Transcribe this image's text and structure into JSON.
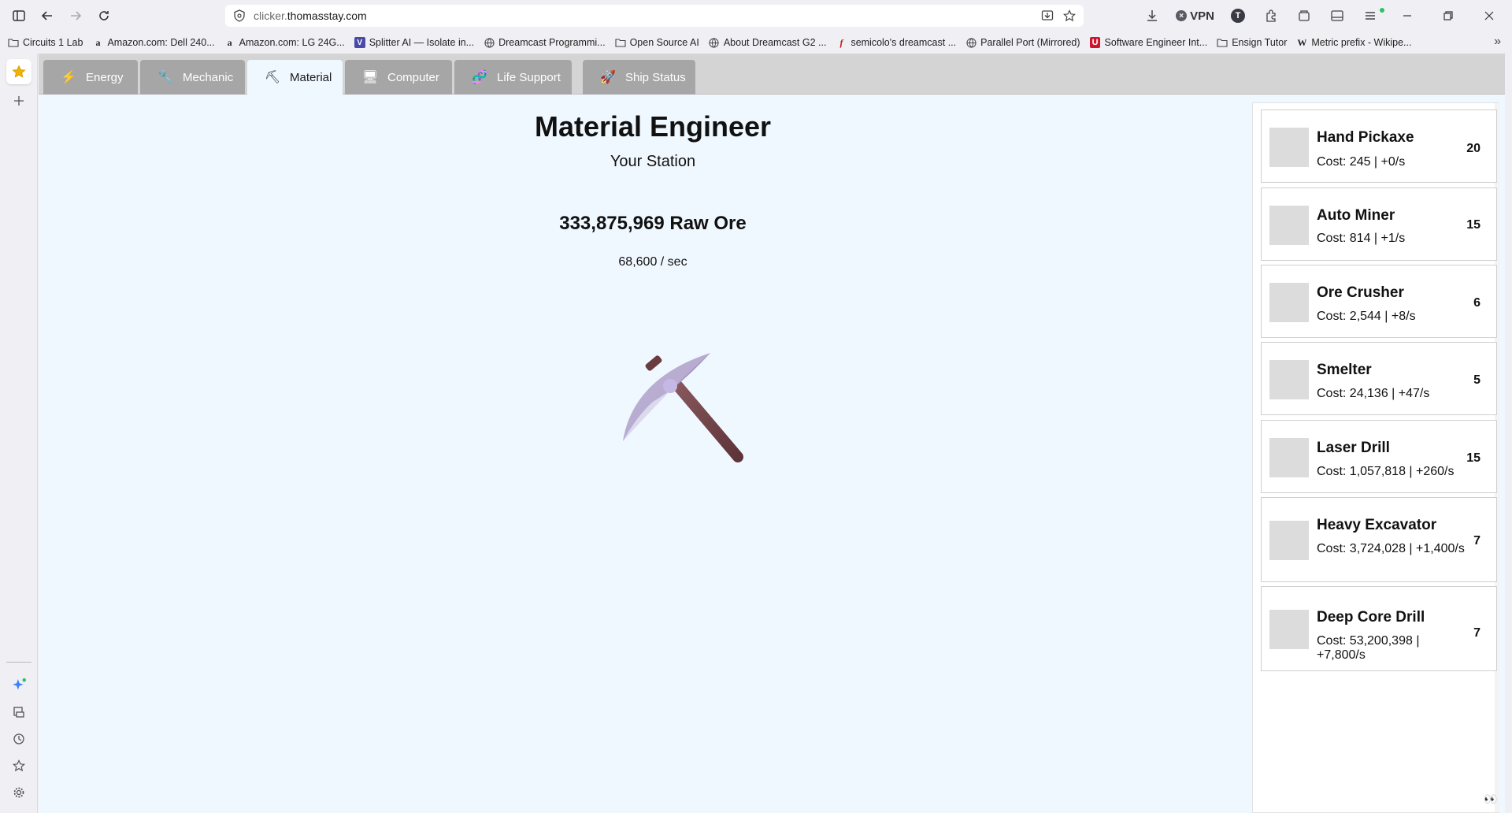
{
  "browser": {
    "url_prefix": "clicker.",
    "url_domain": "thomasstay.com",
    "vpn_label": "VPN",
    "profile_initial": "T"
  },
  "bookmarks": [
    {
      "label": "Circuits 1 Lab",
      "icon": "folder-icon"
    },
    {
      "label": "Amazon.com: Dell 240...",
      "icon": "amazon-icon"
    },
    {
      "label": "Amazon.com: LG 24G...",
      "icon": "amazon-icon"
    },
    {
      "label": "Splitter AI — Isolate in...",
      "icon": "splitter-icon"
    },
    {
      "label": "Dreamcast Programmi...",
      "icon": "globe-icon"
    },
    {
      "label": "Open Source AI",
      "icon": "folder-icon"
    },
    {
      "label": "About Dreamcast G2 ...",
      "icon": "globe-icon"
    },
    {
      "label": "semicolo's dreamcast ...",
      "icon": "f-icon"
    },
    {
      "label": "Parallel Port (Mirrored)",
      "icon": "globe-icon"
    },
    {
      "label": "Software Engineer Int...",
      "icon": "u-icon"
    },
    {
      "label": "Ensign Tutor",
      "icon": "folder-icon"
    },
    {
      "label": "Metric prefix - Wikipe...",
      "icon": "wikipedia-icon"
    }
  ],
  "tabs": [
    {
      "label": "Energy",
      "icon": "lightning-icon",
      "glyph": "⚡"
    },
    {
      "label": "Mechanic",
      "icon": "wrench-icon",
      "glyph": "🔧"
    },
    {
      "label": "Material",
      "icon": "pick-icon",
      "glyph": "⛏"
    },
    {
      "label": "Computer",
      "icon": "monitor-icon",
      "glyph": "🖥"
    },
    {
      "label": "Life Support",
      "icon": "dna-icon",
      "glyph": "🧬"
    },
    {
      "label": "Ship Status",
      "icon": "rocket-icon",
      "glyph": "🚀"
    }
  ],
  "station": {
    "title": "Material Engineer",
    "subtitle": "Your Station",
    "counter": "333,875,969 Raw Ore",
    "rate": "68,600 / sec"
  },
  "shop": [
    {
      "name": "Hand Pickaxe",
      "cost": "Cost: 245 | +0/s",
      "count": "20"
    },
    {
      "name": "Auto Miner",
      "cost": "Cost: 814 | +1/s",
      "count": "15"
    },
    {
      "name": "Ore Crusher",
      "cost": "Cost: 2,544 | +8/s",
      "count": "6"
    },
    {
      "name": "Smelter",
      "cost": "Cost: 24,136 | +47/s",
      "count": "5"
    },
    {
      "name": "Laser Drill",
      "cost": "Cost: 1,057,818 | +260/s",
      "count": "15"
    },
    {
      "name": "Heavy Excavator",
      "cost": "Cost: 3,724,028 | +1,400/s",
      "count": "7"
    },
    {
      "name": "Deep Core Drill",
      "cost": "Cost: 53,200,398 | +7,800/s",
      "count": "7"
    }
  ],
  "colors": {
    "page_bg": "#f0f8ff",
    "tab_inactive": "#a6a6a6",
    "tab_active": "#f0f8ff",
    "pickaxe_head": "#a89bc4",
    "pickaxe_handle": "#7a4a4f"
  }
}
